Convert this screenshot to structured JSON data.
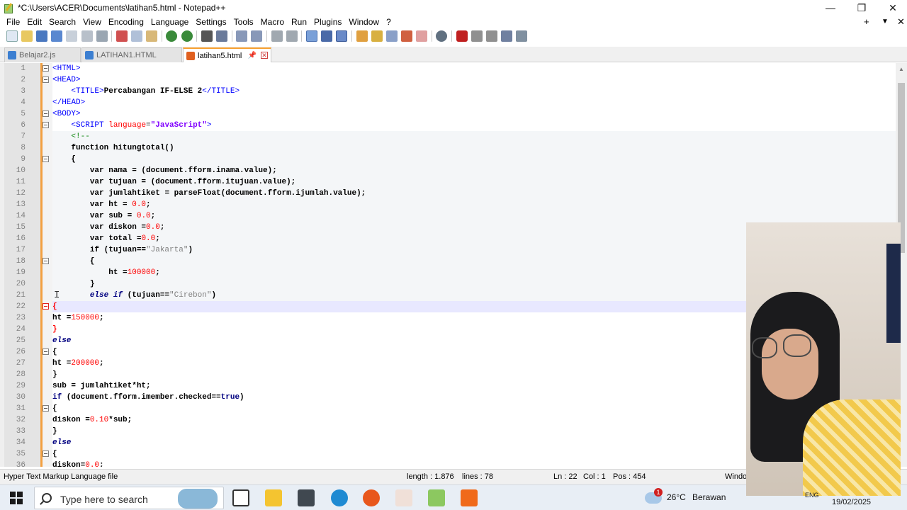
{
  "window": {
    "title": "*C:\\Users\\ACER\\Documents\\latihan5.html - Notepad++"
  },
  "menu": [
    "File",
    "Edit",
    "Search",
    "View",
    "Encoding",
    "Language",
    "Settings",
    "Tools",
    "Macro",
    "Run",
    "Plugins",
    "Window",
    "?"
  ],
  "menu_right": {
    "plus": "+",
    "down": "▼",
    "close": "✕"
  },
  "tabs": [
    {
      "label": "Belajar2.js",
      "active": false
    },
    {
      "label": "LATIHAN1.HTML",
      "active": false
    },
    {
      "label": "latihan5.html",
      "active": true
    }
  ],
  "editor": {
    "current_line": 22,
    "lines": [
      {
        "n": "1",
        "fold": "box"
      },
      {
        "n": "2",
        "fold": "box"
      },
      {
        "n": "3"
      },
      {
        "n": "4"
      },
      {
        "n": "5",
        "fold": "box"
      },
      {
        "n": "6",
        "fold": "box"
      },
      {
        "n": "7"
      },
      {
        "n": "8"
      },
      {
        "n": "9",
        "fold": "box"
      },
      {
        "n": "10"
      },
      {
        "n": "11"
      },
      {
        "n": "12"
      },
      {
        "n": "13"
      },
      {
        "n": "14"
      },
      {
        "n": "15"
      },
      {
        "n": "16"
      },
      {
        "n": "17"
      },
      {
        "n": "18",
        "fold": "box"
      },
      {
        "n": "19"
      },
      {
        "n": "20"
      },
      {
        "n": "21"
      },
      {
        "n": "22",
        "fold": "red"
      },
      {
        "n": "23"
      },
      {
        "n": "24"
      },
      {
        "n": "25"
      },
      {
        "n": "26",
        "fold": "box"
      },
      {
        "n": "27"
      },
      {
        "n": "28"
      },
      {
        "n": "29"
      },
      {
        "n": "30"
      },
      {
        "n": "31",
        "fold": "box"
      },
      {
        "n": "32"
      },
      {
        "n": "33"
      },
      {
        "n": "34"
      },
      {
        "n": "35",
        "fold": "box"
      },
      {
        "n": "36"
      }
    ],
    "code": {
      "l1": "<HTML>",
      "l2": "<HEAD>",
      "l3_open": "<TITLE>",
      "l3_text": "Percabangan IF-ELSE 2",
      "l3_close": "</TITLE>",
      "l4": "</HEAD>",
      "l5": "<BODY>",
      "l6_tag": "<SCRIPT",
      "l6_attr": "language",
      "l6_eq": "=",
      "l6_val": "\"JavaScript\"",
      "l6_end": ">",
      "l7": "<!--",
      "l8_kw": "function",
      "l8_rest": " hitungtotal()",
      "l9": "{",
      "l10_kw": "var",
      "l10_rest": " nama = (document.fform.inama.value);",
      "l11_kw": "var",
      "l11_rest": " tujuan = (document.fform.itujuan.value);",
      "l12_kw": "var",
      "l12_rest": " jumlahtiket = parseFloat(document.fform.ijumlah.value);",
      "l13_kw": "var",
      "l13_a": " ht = ",
      "l13_num": "0.0",
      "l13_b": ";",
      "l14_kw": "var",
      "l14_a": " sub = ",
      "l14_num": "0.0",
      "l14_b": ";",
      "l15_kw": "var",
      "l15_a": " diskon =",
      "l15_num": "0.0",
      "l15_b": ";",
      "l16_kw": "var",
      "l16_a": " total =",
      "l16_num": "0.0",
      "l16_b": ";",
      "l17_kw": "if",
      "l17_a": " (tujuan==",
      "l17_str": "\"Jakarta\"",
      "l17_b": ")",
      "l18": "{",
      "l19_a": "ht =",
      "l19_num": "100000",
      "l19_b": ";",
      "l20": "}",
      "l21_kw": "else if",
      "l21_a": " (tujuan==",
      "l21_str": "\"Cirebon\"",
      "l21_b": ")",
      "l22": "{",
      "l23_a": "ht =",
      "l23_num": "150000",
      "l23_b": ";",
      "l24": "}",
      "l25_kw": "else",
      "l26": "{",
      "l27_a": "ht =",
      "l27_num": "200000",
      "l27_b": ";",
      "l28": "}",
      "l29": "sub = jumlahtiket*ht;",
      "l30_kw": "if",
      "l30_a": " (document.fform.imember.checked==",
      "l30_kw2": "true",
      "l30_b": ")",
      "l31": "{",
      "l32_a": "diskon =",
      "l32_num": "0.10",
      "l32_b": "*sub;",
      "l33": "}",
      "l34_kw": "else",
      "l35": "{",
      "l36_a": "diskon=",
      "l36_num": "0.0",
      "l36_b": ";"
    }
  },
  "status": {
    "filetype": "Hyper Text Markup Language file",
    "length": "length : 1.876",
    "lines": "lines : 78",
    "ln": "Ln : 22",
    "col": "Col : 1",
    "pos": "Pos : 454",
    "eol": "Windo"
  },
  "taskbar": {
    "search_placeholder": "Type here to search",
    "weather_temp": "26°C",
    "weather_desc": "Berawan",
    "lang": "ENG",
    "date": "19/02/2025",
    "notif_count": "1"
  },
  "colors": {
    "tag": "#0000ff",
    "attr": "#ff0000",
    "string": "#8000ff",
    "keyword": "#000080",
    "number": "#ff0000",
    "comment": "#008000",
    "current_line": "#e8e8ff",
    "active_tab_accent": "#f7a030"
  }
}
